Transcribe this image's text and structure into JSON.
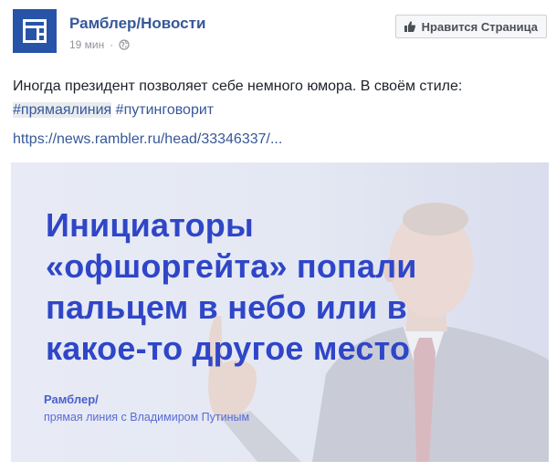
{
  "header": {
    "page_name": "Рамблер/Новости",
    "time": "19 мин",
    "separator": "·",
    "like_page_label": "Нравится Страница"
  },
  "post": {
    "text": "Иногда президент позволяет себе немного юмора. В своём стиле:",
    "hashtags": [
      "#прямаялиния",
      "#путинговорит"
    ],
    "link": "https://news.rambler.ru/head/33346337/..."
  },
  "image": {
    "headline_lines": [
      "Инициаторы",
      "«офшоргейта» попали",
      "пальцем в небо или в",
      "какое-то другое место"
    ],
    "caption_brand": "Рамблер/",
    "caption_sub": "прямая линия с Владимиром Путиным"
  },
  "colors": {
    "brand_blue": "#2754a8",
    "link_blue": "#365899",
    "headline_blue": "#2f46c8",
    "meta_gray": "#90949c"
  },
  "icons": {
    "avatar": "rambler-logo-icon",
    "privacy": "globe-icon",
    "like": "thumbs-up-icon"
  }
}
